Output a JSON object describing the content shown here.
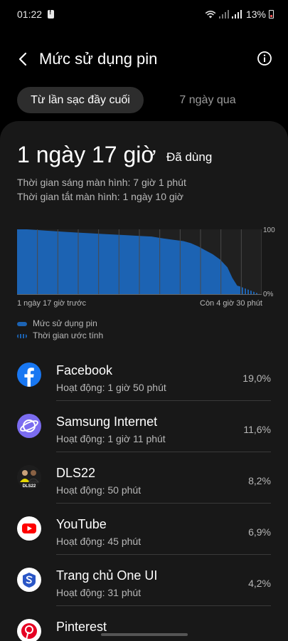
{
  "status_bar": {
    "time": "01:22",
    "battery_percent": "13%",
    "icons": [
      "notification-icon",
      "wifi-icon",
      "signal-icon",
      "signal-icon",
      "battery-icon"
    ]
  },
  "header": {
    "title": "Mức sử dụng pin",
    "back_icon": "back-arrow-icon",
    "info_icon": "info-icon"
  },
  "tabs": [
    {
      "label": "Từ lần sạc đầy cuối",
      "active": true
    },
    {
      "label": "7 ngày qua",
      "active": false
    }
  ],
  "summary": {
    "used_value": "1 ngày 17 giờ",
    "used_label": "Đã dùng",
    "screen_on": "Thời gian sáng màn hình: 7 giờ 1 phút",
    "screen_off": "Thời gian tắt màn hình: 1 ngày 10 giờ"
  },
  "chart_data": {
    "type": "area",
    "y_tick_top": "100",
    "y_tick_bottom": "0%",
    "x_label_start": "1 ngày 17 giờ trước",
    "x_label_end": "Còn 4 giờ 30 phút",
    "ylim": [
      0,
      100
    ],
    "usage_points": [
      [
        0,
        100
      ],
      [
        0.04,
        100
      ],
      [
        0.08,
        99
      ],
      [
        0.12,
        98
      ],
      [
        0.16,
        97
      ],
      [
        0.2,
        96
      ],
      [
        0.25,
        95
      ],
      [
        0.3,
        94
      ],
      [
        0.35,
        93
      ],
      [
        0.4,
        92
      ],
      [
        0.45,
        91
      ],
      [
        0.5,
        90
      ],
      [
        0.55,
        89
      ],
      [
        0.6,
        86
      ],
      [
        0.64,
        84
      ],
      [
        0.68,
        82
      ],
      [
        0.71,
        79
      ],
      [
        0.74,
        74
      ],
      [
        0.77,
        68
      ],
      [
        0.8,
        62
      ],
      [
        0.83,
        54
      ],
      [
        0.86,
        42
      ],
      [
        0.88,
        26
      ],
      [
        0.9,
        14
      ],
      [
        0.91,
        13
      ]
    ],
    "estimate_points": [
      [
        0.91,
        13
      ],
      [
        1.0,
        0
      ]
    ],
    "colors": {
      "usage": "#1c63b3",
      "estimate": "#1c63b3",
      "grid": "#4a4a4a"
    }
  },
  "legend": {
    "usage": "Mức sử dụng pin",
    "estimate": "Thời gian ước tính"
  },
  "apps": [
    {
      "name": "Facebook",
      "active": "Hoạt động: 1 giờ 50 phút",
      "percent": "19,0%",
      "icon": "facebook-icon"
    },
    {
      "name": "Samsung Internet",
      "active": "Hoạt động: 1 giờ 11 phút",
      "percent": "11,6%",
      "icon": "samsung-internet-icon"
    },
    {
      "name": "DLS22",
      "active": "Hoạt động: 50 phút",
      "percent": "8,2%",
      "icon": "dls22-icon",
      "icon_text": "DLS22"
    },
    {
      "name": "YouTube",
      "active": "Hoạt động: 45 phút",
      "percent": "6,9%",
      "icon": "youtube-icon"
    },
    {
      "name": "Trang chủ One UI",
      "active": "Hoạt động: 31 phút",
      "percent": "4,2%",
      "icon": "one-ui-home-icon"
    },
    {
      "name": "Pinterest",
      "active": "",
      "percent": "",
      "icon": "pinterest-icon"
    }
  ]
}
